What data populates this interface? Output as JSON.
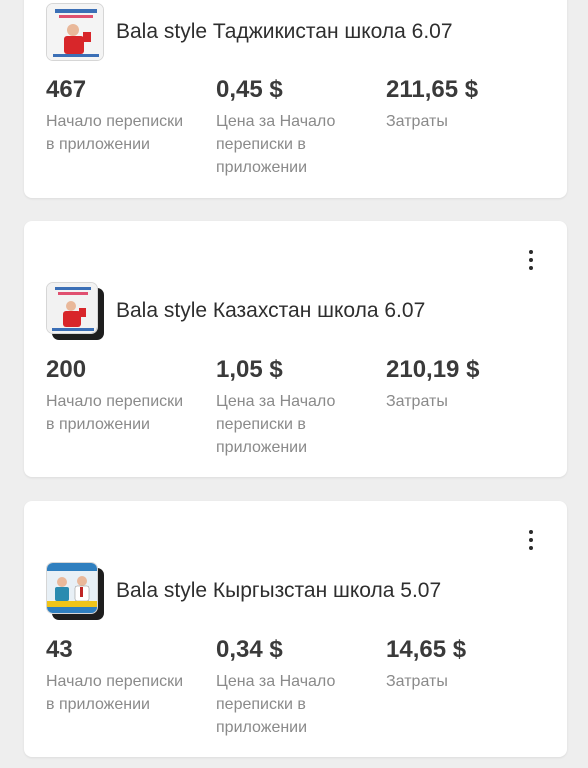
{
  "campaigns": [
    {
      "title": "Bala style Таджикистан школа 6.07",
      "metrics": [
        {
          "value": "467",
          "label": "Начало переписки в приложении"
        },
        {
          "value": "0,45 $",
          "label": "Цена за Начало переписки в приложении"
        },
        {
          "value": "211,65 $",
          "label": "Затраты"
        }
      ]
    },
    {
      "title": "Bala style Казахстан школа 6.07",
      "metrics": [
        {
          "value": "200",
          "label": "Начало переписки в приложении"
        },
        {
          "value": "1,05 $",
          "label": "Цена за Начало переписки в приложении"
        },
        {
          "value": "210,19 $",
          "label": "Затраты"
        }
      ]
    },
    {
      "title": "Bala style Кыргызстан школа 5.07",
      "metrics": [
        {
          "value": "43",
          "label": "Начало переписки в приложении"
        },
        {
          "value": "0,34 $",
          "label": "Цена за Начало переписки в приложении"
        },
        {
          "value": "14,65 $",
          "label": "Затраты"
        }
      ]
    }
  ],
  "icons": {
    "more": "more-vertical-icon",
    "thumbnail": "ad-creative-thumbnail"
  },
  "colors": {
    "background": "#eeeeee",
    "card": "#ffffff",
    "value_text": "#3a3a3a",
    "label_text": "#8a8a8a"
  }
}
